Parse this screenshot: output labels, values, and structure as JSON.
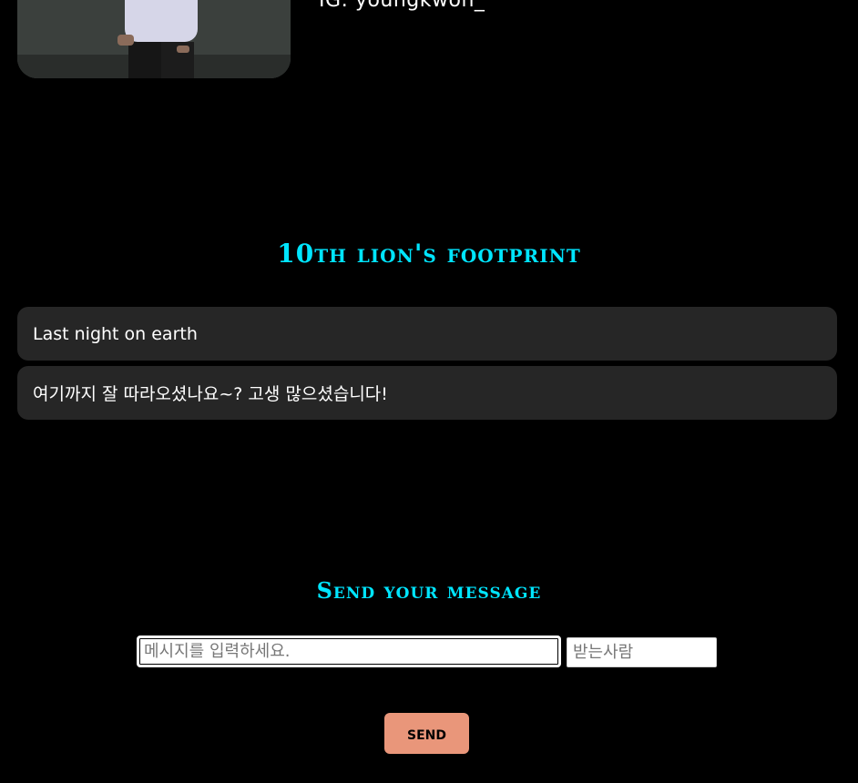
{
  "profile": {
    "handle": "IG: youngkwon_",
    "photo_icon": "person-photo"
  },
  "footprint": {
    "title": "10th lion's footprint",
    "messages": [
      "Last night on earth",
      "여기까지 잘 따라오셨나요~? 고생 많으셨습니다!"
    ]
  },
  "send_form": {
    "title": "Send your message",
    "message_placeholder": "메시지를 입력하세요.",
    "recipient_placeholder": "받는사람",
    "send_label": "SEND"
  },
  "colors": {
    "background": "#000000",
    "accent_title": "#00e5ff",
    "card_background": "#262626",
    "send_button": "#e9967a"
  }
}
